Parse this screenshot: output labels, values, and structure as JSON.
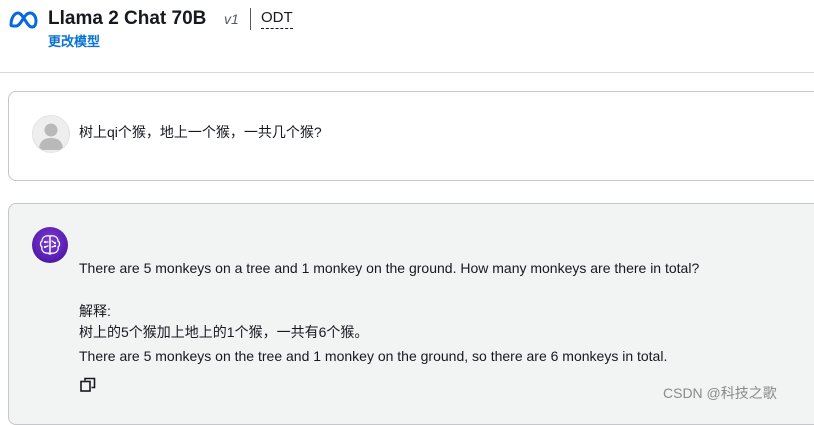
{
  "header": {
    "model_title": "Llama 2 Chat 70B",
    "model_version": "v1",
    "provider_label": "ODT",
    "change_model_label": "更改模型",
    "logo_icon": "meta-logo-icon"
  },
  "conversation": {
    "user_message": {
      "avatar_icon": "user-avatar-icon",
      "text": "树上qi个猴，地上一个猴，一共几个猴?"
    },
    "assistant_message": {
      "avatar_icon": "assistant-brain-icon",
      "lines": [
        "There are 5 monkeys on a tree and 1 monkey on the ground. How many monkeys are there in total?",
        "解释:",
        "树上的5个猴加上地上的1个猴，一共有6个猴。",
        "There are 5 monkeys on the tree and 1 monkey on the ground, so there are 6 monkeys in total."
      ],
      "copy_icon": "copy-icon"
    }
  },
  "watermark": "CSDN @科技之歌",
  "colors": {
    "accent_link": "#0972d3",
    "meta_blue": "#0668e1",
    "assistant_avatar": "#5a1fb3",
    "assistant_card_bg": "#f2f3f3"
  }
}
